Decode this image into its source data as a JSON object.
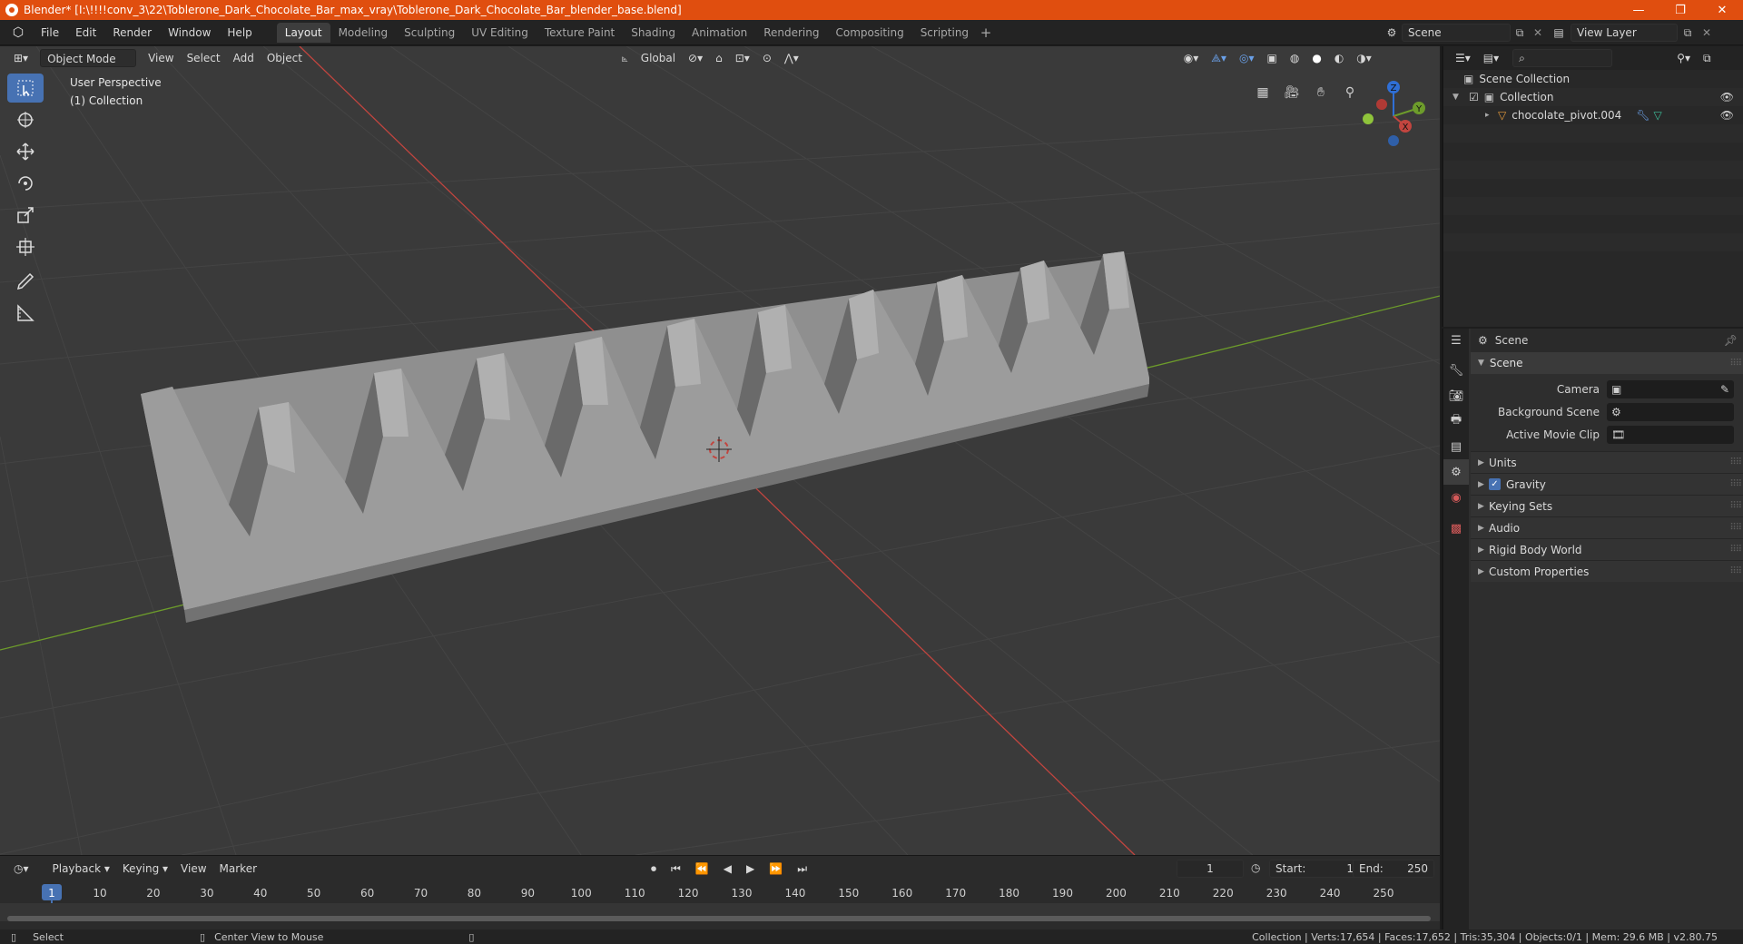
{
  "titlebar": {
    "title": "Blender* [I:\\!!!!conv_3\\22\\Toblerone_Dark_Chocolate_Bar_max_vray\\Toblerone_Dark_Chocolate_Bar_blender_base.blend]",
    "minimize": "—",
    "maximize": "❐",
    "close": "✕"
  },
  "menu": [
    "File",
    "Edit",
    "Render",
    "Window",
    "Help"
  ],
  "workspaces": [
    "Layout",
    "Modeling",
    "Sculpting",
    "UV Editing",
    "Texture Paint",
    "Shading",
    "Animation",
    "Rendering",
    "Compositing",
    "Scripting"
  ],
  "workspace_add": "+",
  "scene_selector": {
    "scene": "Scene",
    "view_layer": "View Layer"
  },
  "viewport": {
    "mode": "Object Mode",
    "menus": [
      "View",
      "Select",
      "Add",
      "Object"
    ],
    "orientation": "Global",
    "overlay_title": "User Perspective",
    "overlay_collection": "(1) Collection",
    "gizmo_axes": {
      "x": "X",
      "y": "Y",
      "z": "Z"
    },
    "tools": [
      "select-box",
      "cursor",
      "move",
      "rotate",
      "scale",
      "transform",
      "annotate",
      "measure"
    ]
  },
  "timeline": {
    "menus": [
      "Playback",
      "Keying",
      "View",
      "Marker"
    ],
    "current_frame": "1",
    "start_label": "Start:",
    "start": "1",
    "end_label": "End:",
    "end": "250",
    "ruler": [
      "1",
      "10",
      "20",
      "30",
      "40",
      "50",
      "60",
      "70",
      "80",
      "90",
      "100",
      "110",
      "120",
      "130",
      "140",
      "150",
      "160",
      "170",
      "180",
      "190",
      "200",
      "210",
      "220",
      "230",
      "240",
      "250"
    ]
  },
  "statusbar": {
    "select": "Select",
    "center": "Center View to Mouse",
    "stats": "Collection | Verts:17,654 | Faces:17,652 | Tris:35,304 | Objects:0/1 | Mem: 29.6 MB | v2.80.75"
  },
  "outliner": {
    "root": "Scene Collection",
    "collection": "Collection",
    "object": "chocolate_pivot.004"
  },
  "properties": {
    "header": "Scene",
    "panel": "Scene",
    "rows": [
      {
        "label": "Camera"
      },
      {
        "label": "Background Scene"
      },
      {
        "label": "Active Movie Clip"
      }
    ],
    "subpanels": [
      "Units",
      "Gravity",
      "Keying Sets",
      "Audio",
      "Rigid Body World",
      "Custom Properties"
    ]
  },
  "colors": {
    "accent": "#4772b3",
    "titlebar": "#e04e0f",
    "x_axis": "#c2453f",
    "y_axis": "#6d9c2b"
  }
}
